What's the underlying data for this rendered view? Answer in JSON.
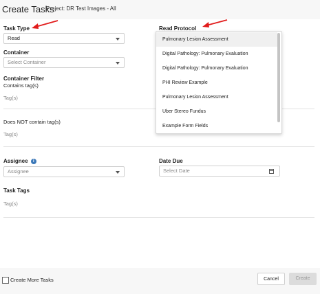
{
  "header": {
    "title": "Create Tasks",
    "project": "Project: DR Test Images - All"
  },
  "form": {
    "task_type": {
      "label": "Task Type",
      "value": "Read"
    },
    "container": {
      "label": "Container",
      "placeholder": "Select Container"
    },
    "container_filter": {
      "label": "Container Filter",
      "contains_label": "Contains tag(s)",
      "contains_placeholder": "Tag(s)",
      "not_contains_label": "Does NOT contain tag(s)",
      "not_contains_placeholder": "Tag(s)"
    },
    "assignee": {
      "label": "Assignee",
      "placeholder": "Assignee",
      "info_icon": "i"
    },
    "date_due": {
      "label": "Date Due",
      "placeholder": "Select Date"
    },
    "task_tags": {
      "label": "Task Tags",
      "placeholder": "Tag(s)"
    },
    "read_protocol": {
      "label": "Read Protocol",
      "options": [
        "Pulmonary Lesion Assessment",
        "Digital Pathology: Pulmonary Evaluation",
        "Digital Pathology: Pulmonary Evaluation",
        "PHI Review Example",
        "Pulmonary Lesion Assessment",
        "Uber Stereo Fundus",
        "Example Form Fields"
      ]
    }
  },
  "footer": {
    "create_more_label": "Create More Tasks",
    "cancel_label": "Cancel",
    "create_label": "Create"
  },
  "colors": {
    "annotation_arrow": "#e11b1b",
    "info": "#3b78b8"
  }
}
